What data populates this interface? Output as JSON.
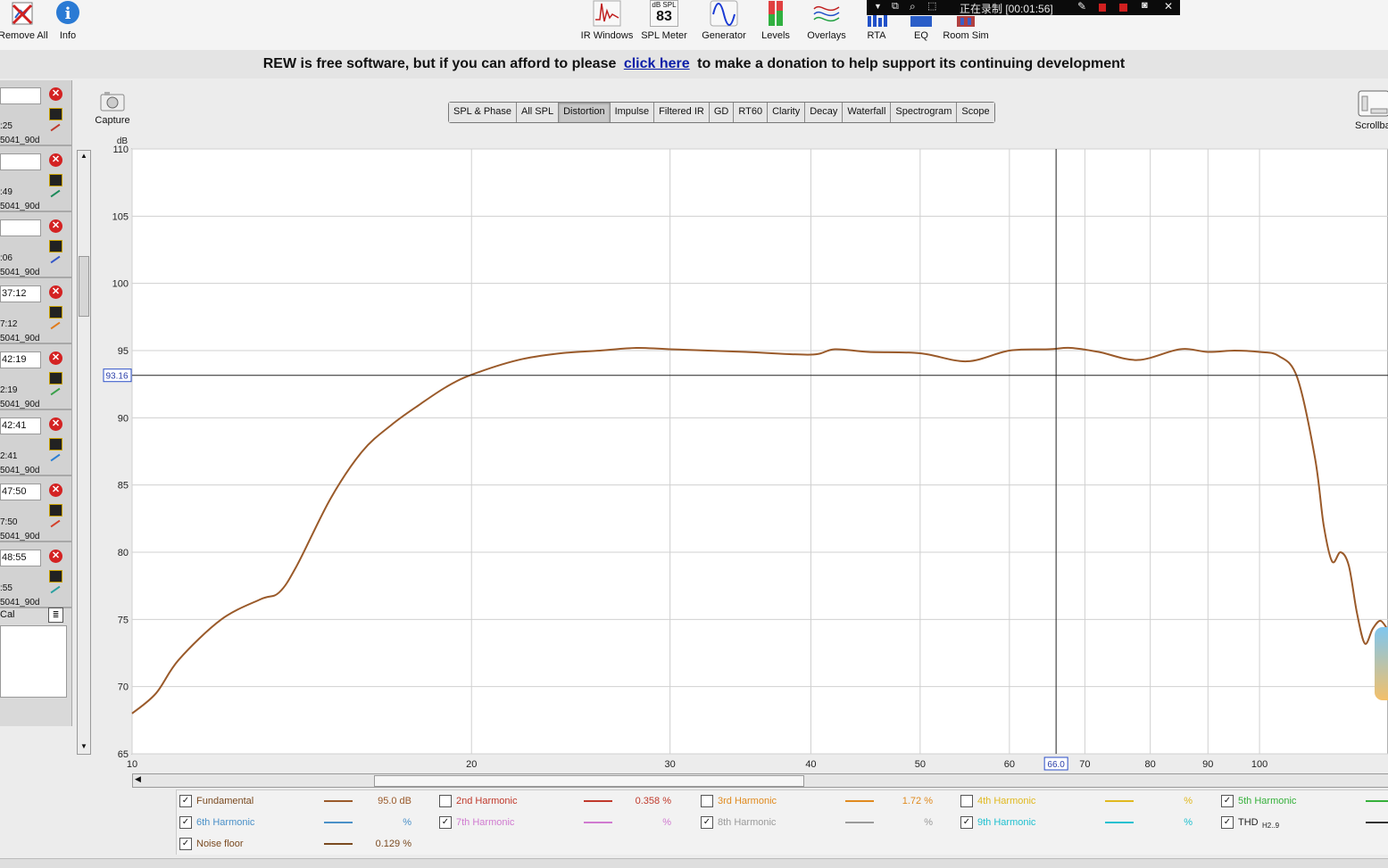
{
  "toolbar": {
    "left": [
      {
        "label": "Remove All",
        "icon": "remove-all-icon"
      },
      {
        "label": "Info",
        "icon": "info-icon"
      }
    ],
    "right": [
      {
        "label": "IR Windows",
        "icon": "ir-windows-icon"
      },
      {
        "label": "SPL Meter",
        "icon": "spl-meter-icon",
        "badge_top": "dB SPL",
        "badge_value": "83"
      },
      {
        "label": "Generator",
        "icon": "generator-icon"
      },
      {
        "label": "Levels",
        "icon": "levels-icon"
      },
      {
        "label": "Overlays",
        "icon": "overlays-icon"
      },
      {
        "label": "RTA",
        "icon": "rta-icon"
      },
      {
        "label": "EQ",
        "icon": "eq-icon"
      },
      {
        "label": "Room Sim",
        "icon": "room-sim-icon"
      }
    ]
  },
  "recording": {
    "text": "正在录制 [00:01:56]"
  },
  "banner": {
    "before": "REW is free software, but if you can afford to please",
    "link": "click here",
    "after": "to make a donation to help support its continuing development"
  },
  "measurements": [
    {
      "name": "",
      "time": ":25",
      "file": "5041_90d",
      "color": "#c0392b"
    },
    {
      "name": "",
      "time": ":49",
      "file": "5041_90d",
      "color": "#1b8a5a"
    },
    {
      "name": "",
      "time": ":06",
      "file": "5041_90d",
      "color": "#3356c8"
    },
    {
      "name": "37:12",
      "time": "7:12",
      "file": "5041_90d",
      "color": "#e07b1a"
    },
    {
      "name": "42:19",
      "time": "2:19",
      "file": "5041_90d",
      "color": "#3aa04a"
    },
    {
      "name": "42:41",
      "time": "2:41",
      "file": "5041_90d",
      "color": "#2a7fd4"
    },
    {
      "name": "47:50",
      "time": "7:50",
      "file": "5041_90d",
      "color": "#d4402a"
    },
    {
      "name": "48:55",
      "time": ":55",
      "file": "5041_90d",
      "color": "#2aa0a0"
    }
  ],
  "cal_label": "Cal",
  "capture": {
    "label": "Capture"
  },
  "scrollbars_label": "Scrollba",
  "tabs": [
    "SPL & Phase",
    "All SPL",
    "Distortion",
    "Impulse",
    "Filtered IR",
    "GD",
    "RT60",
    "Clarity",
    "Decay",
    "Waterfall",
    "Spectrogram",
    "Scope"
  ],
  "active_tab": "Distortion",
  "graph": {
    "y_unit": "dB",
    "y_ticks": [
      "110",
      "105",
      "100",
      "95",
      "90",
      "85",
      "80",
      "75",
      "70",
      "65"
    ],
    "x_ticks": [
      "10",
      "20",
      "30",
      "40",
      "50",
      "60",
      "70",
      "80",
      "90",
      "100"
    ],
    "cursor_y": "93.16",
    "cursor_x": "66.0"
  },
  "chart_data": {
    "type": "line",
    "x_scale": "log",
    "xlim": [
      10,
      130
    ],
    "ylim": [
      65,
      110
    ],
    "grid": true,
    "series": [
      {
        "name": "Fundamental",
        "color": "#9a5a2a",
        "x": [
          10,
          10.5,
          11,
          12,
          13,
          13.5,
          14,
          15,
          16,
          17,
          18,
          19,
          20,
          22,
          24,
          26,
          28,
          30,
          35,
          40,
          42,
          45,
          50,
          55,
          60,
          65,
          68,
          72,
          78,
          85,
          90,
          95,
          100,
          104,
          108,
          112,
          114,
          116,
          118,
          120,
          122,
          124,
          126,
          128,
          130
        ],
        "y": [
          68.0,
          69.5,
          72.0,
          75.0,
          76.5,
          77.0,
          79.0,
          84.0,
          87.5,
          89.5,
          91.0,
          92.3,
          93.2,
          94.3,
          94.8,
          95.0,
          95.2,
          95.1,
          94.9,
          94.7,
          95.1,
          94.9,
          94.8,
          94.2,
          95.0,
          95.1,
          95.2,
          94.9,
          94.3,
          95.1,
          94.9,
          95.0,
          94.9,
          94.6,
          93.0,
          87.0,
          82.0,
          79.3,
          80.0,
          79.0,
          75.5,
          73.2,
          74.3,
          74.9,
          74.2
        ]
      }
    ]
  },
  "legend": [
    {
      "name": "Fundamental",
      "checked": true,
      "color": "#9a5a2a",
      "value": "95.0 dB"
    },
    {
      "name": "2nd Harmonic",
      "checked": false,
      "color": "#c0392b",
      "value": "0.358 %"
    },
    {
      "name": "3rd Harmonic",
      "checked": false,
      "color": "#e08a1e",
      "value": "1.72 %"
    },
    {
      "name": "4th Harmonic",
      "checked": false,
      "color": "#e0b81e",
      "value": "%"
    },
    {
      "name": "5th Harmonic",
      "checked": true,
      "color": "#35b03a",
      "value": ""
    },
    {
      "name": "6th Harmonic",
      "checked": true,
      "color": "#4a90c8",
      "value": "%"
    },
    {
      "name": "7th Harmonic",
      "checked": true,
      "color": "#d07ad0",
      "value": "%"
    },
    {
      "name": "8th Harmonic",
      "checked": true,
      "color": "#9a9a9a",
      "value": "%"
    },
    {
      "name": "9th Harmonic",
      "checked": true,
      "color": "#20c0d0",
      "value": "%"
    },
    {
      "name": "THD",
      "sub": "H2..9",
      "checked": true,
      "color": "#333333",
      "value": ""
    },
    {
      "name": "Noise floor",
      "checked": true,
      "color": "#7a4a20",
      "value": "0.129 %"
    }
  ]
}
